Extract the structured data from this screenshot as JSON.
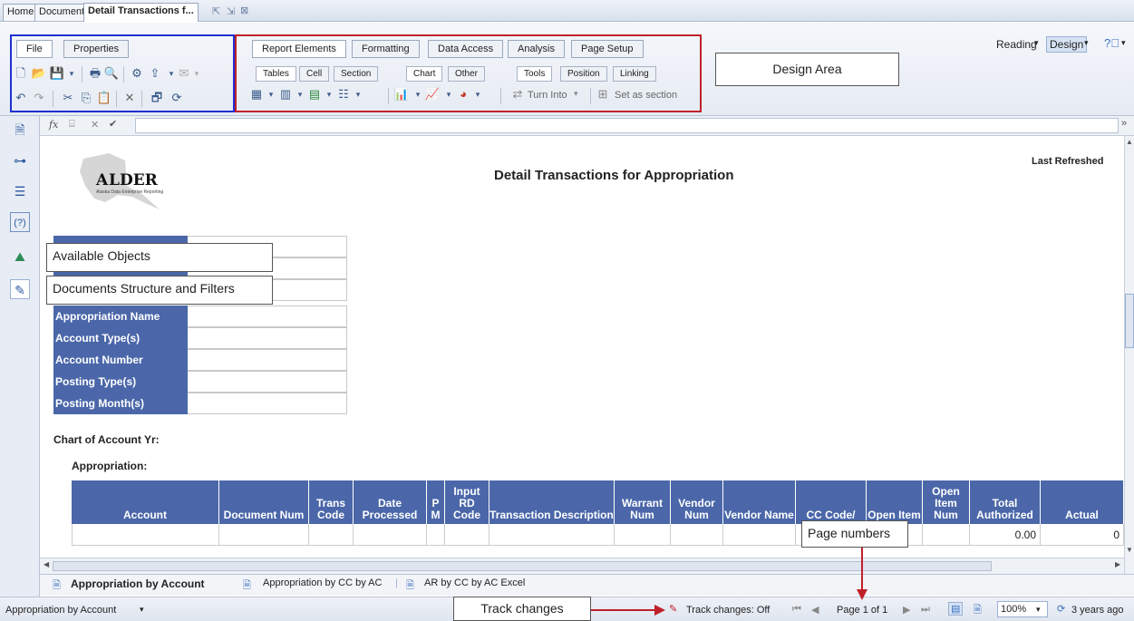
{
  "tabs": {
    "home": "Home",
    "documents": "Documents",
    "detail": "Detail Transactions f..."
  },
  "ribbon": {
    "left_tabs": [
      "File",
      "Properties"
    ],
    "main_tabs": [
      "Report Elements",
      "Formatting",
      "Data Access",
      "Analysis",
      "Page Setup"
    ],
    "sub_tabs": [
      "Tables",
      "Cell",
      "Section",
      "Chart",
      "Other",
      "Tools",
      "Position",
      "Linking"
    ],
    "turn_into": "Turn Into",
    "set_as_section": "Set as section",
    "reading": "Reading",
    "design": "Design"
  },
  "callouts": {
    "design_area": "Design Area",
    "available_objects": "Available Objects",
    "doc_structure": "Documents Structure and Filters",
    "page_numbers": "Page numbers",
    "track_changes": "Track changes"
  },
  "report": {
    "logo_text": "LDER",
    "logo_initial": "A",
    "logo_sub": "Alaska Data Enterprise Reporting",
    "title": "Detail Transactions for Appropriation",
    "last_refreshed": "Last Refreshed",
    "filters": [
      "Appropriation Name",
      "Account Type(s)",
      "Account Number",
      "Posting Type(s)",
      "Posting Month(s)"
    ],
    "chart_of_account": "Chart of Account Yr:",
    "appropriation": "Appropriation:",
    "columns": [
      "Account",
      "Document Num",
      "Trans Code",
      "Date Processed",
      "P M",
      "Input RD Code",
      "Transaction Description",
      "Warrant Num",
      "Vendor Num",
      "Vendor Name",
      "CC Code/",
      "Open Item",
      "Open Item Num",
      "Total Authorized",
      "Actual"
    ],
    "total_authorized_value": "0.00",
    "actual_value": "0"
  },
  "sheets": [
    "Appropriation by Account",
    "Appropriation by CC by AC",
    "AR by CC by AC Excel"
  ],
  "status": {
    "current_report": "Appropriation by Account",
    "track_changes": "Track changes: Off",
    "page": "Page 1 of 1",
    "zoom": "100%",
    "refreshed": "3 years ago"
  },
  "colors": {
    "header_blue": "#4b67a9",
    "annotation_red": "#c0202a",
    "annotation_blue": "#1f2fd0"
  }
}
